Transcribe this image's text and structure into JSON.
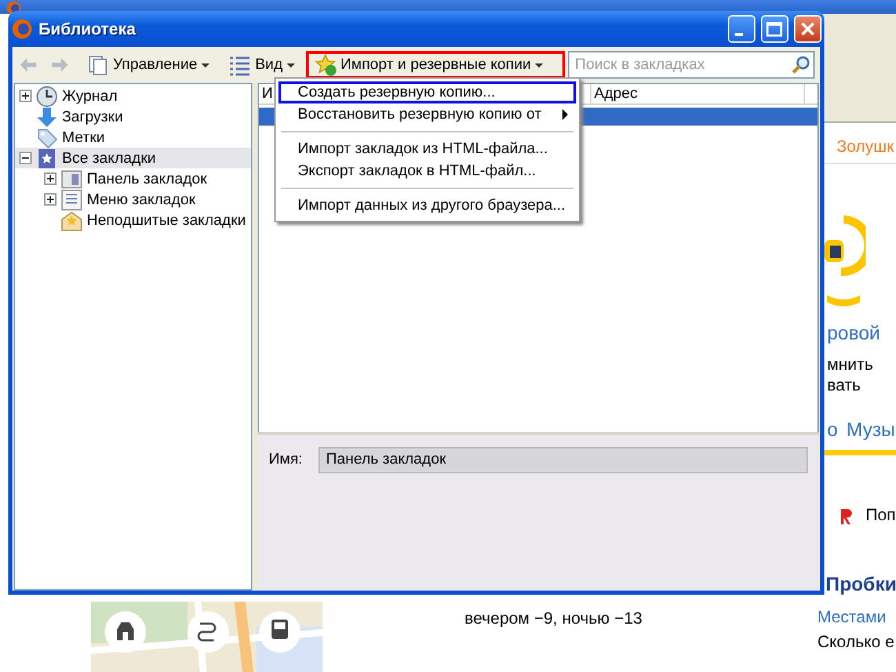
{
  "browser": {
    "fragments": [
      {
        "text": "Золушк",
        "kind": "orange-link"
      },
      {
        "text": "ровой",
        "kind": "blue-large"
      },
      {
        "text": "мнить",
        "kind": "plain"
      },
      {
        "text": "вать",
        "kind": "plain"
      },
      {
        "text": "о",
        "kind": "blue-large"
      },
      {
        "text": "Музы",
        "kind": "blue-large"
      },
      {
        "text": "Поп",
        "kind": "plain"
      },
      {
        "text": "Пробки",
        "kind": "heading"
      },
      {
        "text": "Местами",
        "kind": "blue-link"
      },
      {
        "text": "Сколько е",
        "kind": "plain"
      }
    ],
    "forecast": "вечером −9,  ночью −13"
  },
  "window": {
    "title": "Библиотека",
    "toolbar": [
      {
        "kind": "organize",
        "label": "Управление",
        "open": false
      },
      {
        "kind": "views",
        "label": "Вид",
        "open": false
      },
      {
        "kind": "import",
        "label": "Импорт и резервные копии",
        "open": true
      }
    ],
    "search": {
      "placeholder": "Поиск в закладках"
    },
    "tree": [
      {
        "label": "Журнал",
        "kind": "history",
        "expanded": false,
        "selected": false
      },
      {
        "label": "Загрузки",
        "kind": "downloads",
        "selected": false
      },
      {
        "label": "Метки",
        "kind": "tags",
        "selected": false
      },
      {
        "label": "Все закладки",
        "kind": "all",
        "expanded": true,
        "selected": true,
        "children": [
          {
            "label": "Панель закладок",
            "kind": "toolbar",
            "expanded": false,
            "selected": false
          },
          {
            "label": "Меню закладок",
            "kind": "menu",
            "expanded": false,
            "selected": false
          },
          {
            "label": "Неподшитые закладки",
            "kind": "unsorted",
            "selected": false
          }
        ]
      }
    ],
    "table": {
      "columns": [
        "И",
        "Адрес"
      ],
      "rows": [
        {
          "selected": true
        }
      ]
    },
    "details": {
      "name_label": "Имя:",
      "name_value": "Панель закладок"
    },
    "menu": [
      {
        "kind": "item",
        "label": "Создать резервную копию...",
        "selected": true
      },
      {
        "kind": "submenu",
        "label": "Восстановить резервную копию от",
        "selected": false
      },
      {
        "kind": "separator"
      },
      {
        "kind": "item",
        "label": "Импорт закладок из HTML-файла...",
        "selected": false
      },
      {
        "kind": "item",
        "label": "Экспорт закладок в HTML-файл...",
        "selected": false
      },
      {
        "kind": "separator"
      },
      {
        "kind": "item",
        "label": "Импорт данных из другого браузера...",
        "selected": false
      }
    ]
  }
}
